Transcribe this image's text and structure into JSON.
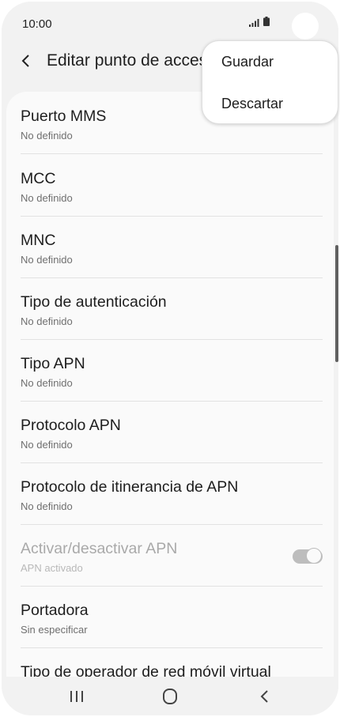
{
  "status_bar": {
    "time": "10:00",
    "signal_icon": "signal-icon",
    "battery_icon": "battery-icon"
  },
  "app_bar": {
    "back_icon": "chevron-left-icon",
    "title": "Editar punto de acceso"
  },
  "menu": {
    "items": [
      {
        "label": "Guardar"
      },
      {
        "label": "Descartar"
      }
    ]
  },
  "settings": {
    "items": [
      {
        "title": "Puerto MMS",
        "subtitle": "No definido"
      },
      {
        "title": "MCC",
        "subtitle": "No definido"
      },
      {
        "title": "MNC",
        "subtitle": "No definido"
      },
      {
        "title": "Tipo de autenticación",
        "subtitle": "No definido"
      },
      {
        "title": "Tipo APN",
        "subtitle": "No definido"
      },
      {
        "title": "Protocolo APN",
        "subtitle": "No definido"
      },
      {
        "title": "Protocolo de itinerancia de APN",
        "subtitle": "No definido"
      },
      {
        "title": "Activar/desactivar APN",
        "subtitle": "APN activado",
        "toggle_on": true,
        "disabled": true
      },
      {
        "title": "Portadora",
        "subtitle": "Sin especificar"
      },
      {
        "title": "Tipo de operador de red móvil virtual",
        "subtitle": ""
      }
    ]
  },
  "nav_bar": {
    "recents_icon": "recents-icon",
    "home_icon": "home-icon",
    "back_icon": "back-icon"
  },
  "colors": {
    "background": "#f2f2f2",
    "card": "#fafafa",
    "divider": "#e2e2e2",
    "toggle": "#bdbdbd"
  }
}
